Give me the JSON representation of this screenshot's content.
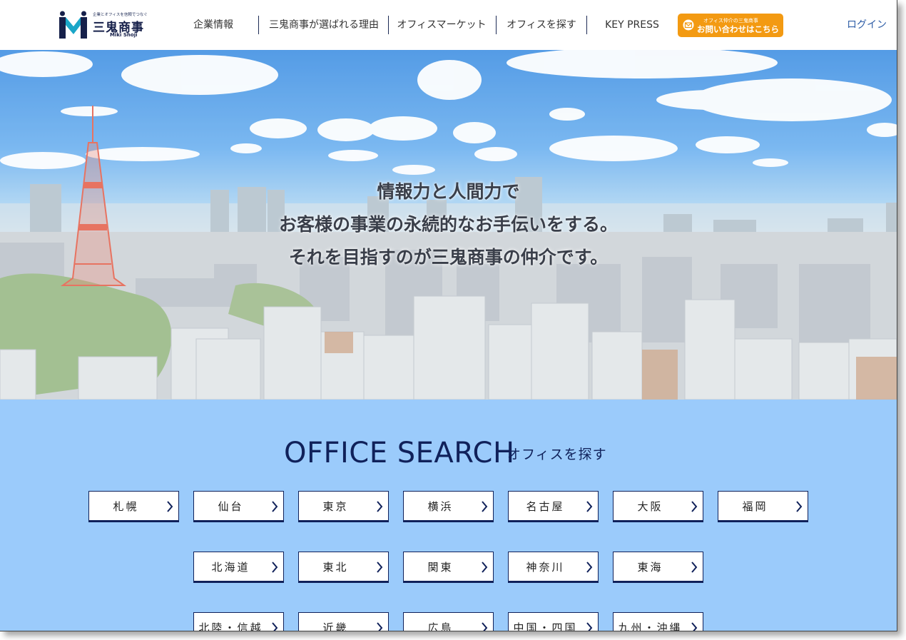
{
  "brand": {
    "tagline": "企業とオフィスを信頼でつなぐ",
    "name": "三鬼商事",
    "romaji": "Miki Shoji",
    "colors": {
      "navy": "#16204a",
      "teal": "#1aa6c8"
    }
  },
  "nav": {
    "items": [
      {
        "label": "企業情報"
      },
      {
        "label": "三鬼商事が選ばれる理由"
      },
      {
        "label": "オフィスマーケット"
      },
      {
        "label": "オフィスを探す"
      },
      {
        "label": "KEY PRESS"
      }
    ],
    "contact": {
      "small": "オフィス仲介の三鬼商事",
      "label": "お問い合わせはこちら",
      "icon": "mail-icon",
      "color": "#f39a12"
    },
    "login": "ログイン"
  },
  "hero": {
    "lines": [
      "情報力と人間力で",
      "お客様の事業の永続的なお手伝いをする。",
      "それを目指すのが三鬼商事の仲介です。"
    ]
  },
  "office_search": {
    "title": "OFFICE SEARCH",
    "subtitle": "オフィスを探す",
    "background": "#9bcbfb",
    "rows": [
      [
        {
          "label": "札幌"
        },
        {
          "label": "仙台"
        },
        {
          "label": "東京"
        },
        {
          "label": "横浜"
        },
        {
          "label": "名古屋"
        },
        {
          "label": "大阪"
        },
        {
          "label": "福岡"
        }
      ],
      [
        {
          "label": "北海道"
        },
        {
          "label": "東北"
        },
        {
          "label": "関東"
        },
        {
          "label": "神奈川"
        },
        {
          "label": "東海"
        }
      ],
      [
        {
          "label": "北陸・信越"
        },
        {
          "label": "近畿"
        },
        {
          "label": "広島"
        },
        {
          "label": "中国・四国"
        },
        {
          "label": "九州・沖縄"
        }
      ]
    ]
  }
}
